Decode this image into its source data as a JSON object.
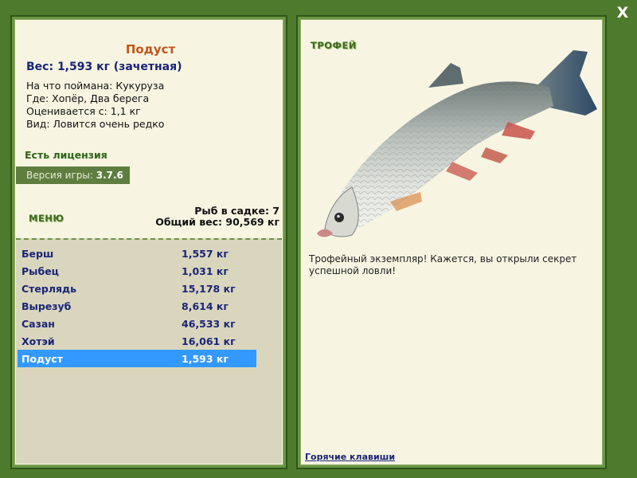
{
  "close_label": "X",
  "fish": {
    "name": "Подуст",
    "weight_line": "Вес: 1,593 кг (зачетная)",
    "bait": "На что поймана: Кукуруза",
    "place": "Где: Хопёр, Два берега",
    "min_weight": "Оценивается с: 1,1 кг",
    "rarity": "Вид: Ловится очень редко"
  },
  "license": "Есть лицензия",
  "version": {
    "label": "Версия игры:",
    "value": "3.7.6"
  },
  "menu_label": "МЕНЮ",
  "keepnet": {
    "count": "Рыб в садке: 7",
    "total": "Общий вес: 90,569 кг"
  },
  "catch_list": [
    {
      "name": "Берш",
      "weight": "1,557 кг"
    },
    {
      "name": "Рыбец",
      "weight": "1,031 кг"
    },
    {
      "name": "Стерлядь",
      "weight": "15,178 кг"
    },
    {
      "name": "Вырезуб",
      "weight": "8,614 кг"
    },
    {
      "name": "Сазан",
      "weight": "46,533 кг"
    },
    {
      "name": "Хотэй",
      "weight": "16,061 кг"
    },
    {
      "name": "Подуст",
      "weight": "1,593 кг"
    }
  ],
  "selected_index": 6,
  "trophy": {
    "label": "ТРОФЕЙ",
    "message": "Трофейный экземпляр! Кажется, вы открыли секрет успешной ловли!",
    "fish_image": "fish-illustration"
  },
  "hotkeys": "Горячие клавиши",
  "colors": {
    "background": "#4d7a2c",
    "panel": "#f7f5e1",
    "list_bg": "#d9d6bd",
    "selection": "#3399ff",
    "accent_name": "#c2541a",
    "text_blue": "#1a2478"
  }
}
